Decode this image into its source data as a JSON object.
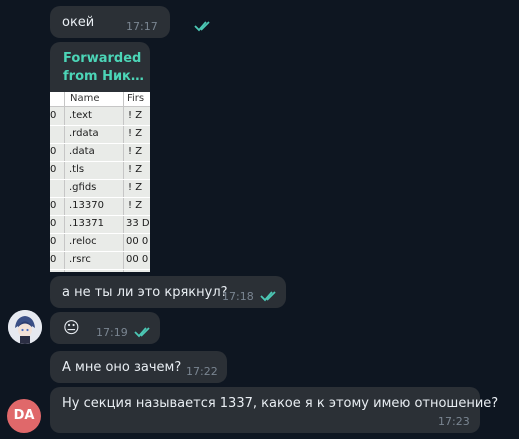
{
  "messages": [
    {
      "text": "окей",
      "time": "17:17",
      "read": true
    },
    {
      "forwarded_label": "Forwarded",
      "forwarded_from": "from Ник…",
      "table": {
        "columns": [
          "Name",
          "Firs"
        ],
        "rows": [
          {
            "left": "0",
            "name": ".text",
            "first": "! Z"
          },
          {
            "left": "",
            "name": ".rdata",
            "first": "! Z"
          },
          {
            "left": "0",
            "name": ".data",
            "first": "! Z"
          },
          {
            "left": "0",
            "name": ".tls",
            "first": "! Z"
          },
          {
            "left": "",
            "name": ".gfids",
            "first": "! Z"
          },
          {
            "left": "0",
            "name": ".13370",
            "first": "! Z"
          },
          {
            "left": "0",
            "name": ".13371",
            "first": "33 D"
          },
          {
            "left": "0",
            "name": ".reloc",
            "first": "00 0"
          },
          {
            "left": "0",
            "name": ".rsrc",
            "first": "00 0"
          }
        ]
      }
    },
    {
      "text": "а не ты ли это крякнул?",
      "time": "17:18",
      "read": true
    },
    {
      "text": "😐",
      "time": "17:19",
      "read": true
    },
    {
      "text": "А мне оно зачем?",
      "time": "17:22"
    },
    {
      "text": "Ну секция называется 1337, какое я к этому имею отношение?",
      "time": "17:23"
    }
  ],
  "avatars": {
    "anime_user": {
      "icon": "anime-avatar-icon"
    },
    "da_user": {
      "initials": "DA",
      "color": "#e0686a"
    }
  },
  "colors": {
    "background": "#0e1621",
    "bubble": "#2b3036",
    "accent": "#4cd5b7",
    "check": "#4cc8b5"
  }
}
